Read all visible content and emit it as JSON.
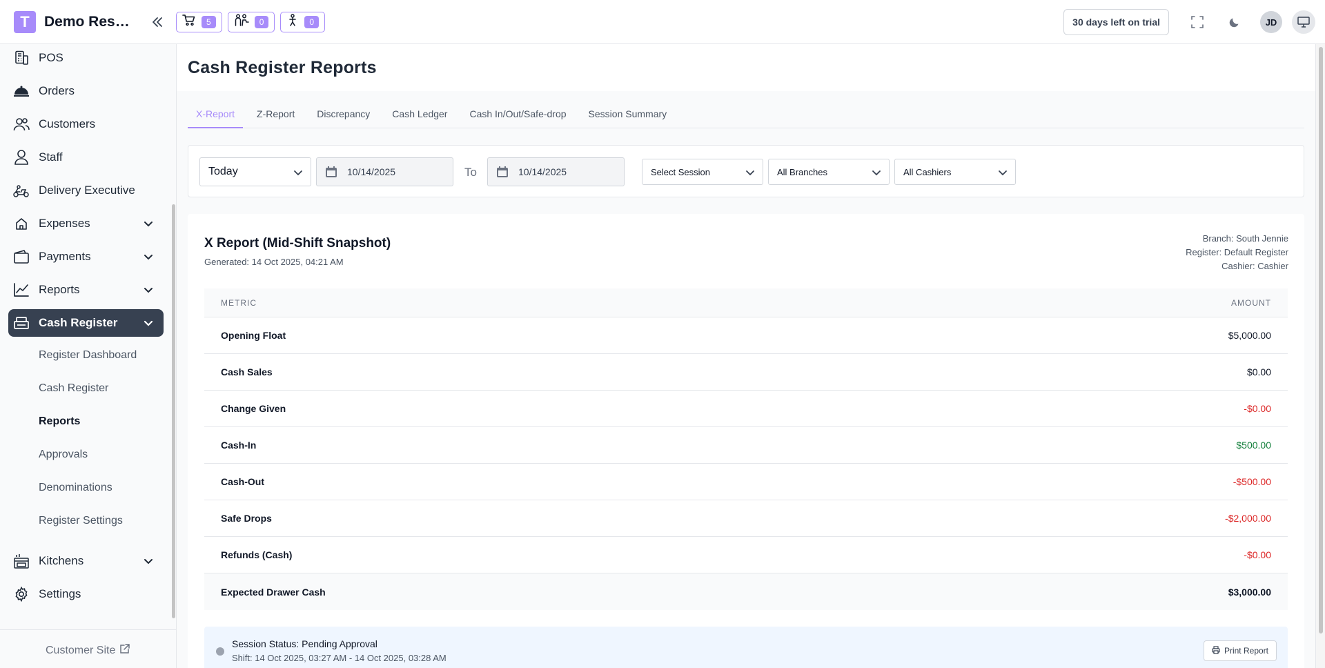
{
  "app": {
    "logo_letter": "T",
    "name": "Demo Restaurant"
  },
  "topbar": {
    "badges": [
      {
        "icon": "cart-icon",
        "count": "5"
      },
      {
        "icon": "waiter-icon",
        "count": "0"
      },
      {
        "icon": "delivery-person-icon",
        "count": "0"
      }
    ],
    "trial": "30 days left on trial",
    "user_initials": "JD"
  },
  "sidebar": {
    "items": [
      {
        "label": "POS",
        "icon": "pos-icon"
      },
      {
        "label": "Orders",
        "icon": "cloche-icon"
      },
      {
        "label": "Customers",
        "icon": "users-icon"
      },
      {
        "label": "Staff",
        "icon": "user-icon"
      },
      {
        "label": "Delivery Executive",
        "icon": "scooter-icon"
      },
      {
        "label": "Expenses",
        "icon": "expenses-icon"
      },
      {
        "label": "Payments",
        "icon": "wallet-icon"
      },
      {
        "label": "Reports",
        "icon": "chart-icon"
      },
      {
        "label": "Cash Register",
        "icon": "register-icon"
      },
      {
        "label": "Kitchens",
        "icon": "kitchen-icon"
      },
      {
        "label": "Settings",
        "icon": "gear-icon"
      }
    ],
    "cash_register_sub": [
      "Register Dashboard",
      "Cash Register",
      "Reports",
      "Approvals",
      "Denominations",
      "Register Settings"
    ],
    "customer_site": "Customer Site"
  },
  "page": {
    "title": "Cash Register Reports",
    "tabs": [
      "X-Report",
      "Z-Report",
      "Discrepancy",
      "Cash Ledger",
      "Cash In/Out/Safe-drop",
      "Session Summary"
    ],
    "active_tab": "X-Report"
  },
  "filters": {
    "period": "Today",
    "date_from": "10/14/2025",
    "to_label": "To",
    "date_to": "10/14/2025",
    "session": "Select Session",
    "branch": "All Branches",
    "cashier": "All Cashiers"
  },
  "report": {
    "title": "X Report (Mid-Shift Snapshot)",
    "generated": "Generated: 14 Oct 2025, 04:21 AM",
    "branch": "Branch: South Jennie",
    "register": "Register: Default Register",
    "cashier": "Cashier: Cashier",
    "col_metric": "METRIC",
    "col_amount": "AMOUNT",
    "rows": [
      {
        "label": "Opening Float",
        "value": "$5,000.00",
        "color": "#111827"
      },
      {
        "label": "Cash Sales",
        "value": "$0.00",
        "color": "#111827"
      },
      {
        "label": "Change Given",
        "value": "-$0.00",
        "color": "#dc2626"
      },
      {
        "label": "Cash-In",
        "value": "$500.00",
        "color": "#15803d"
      },
      {
        "label": "Cash-Out",
        "value": "-$500.00",
        "color": "#dc2626"
      },
      {
        "label": "Safe Drops",
        "value": "-$2,000.00",
        "color": "#dc2626"
      },
      {
        "label": "Refunds (Cash)",
        "value": "-$0.00",
        "color": "#dc2626"
      }
    ],
    "total_label": "Expected Drawer Cash",
    "total_value": "$3,000.00",
    "status": "Session Status: Pending Approval",
    "shift": "Shift: 14 Oct 2025, 03:27 AM - 14 Oct 2025, 03:28 AM",
    "print_label": "Print Report"
  },
  "colors": {
    "accent": "#a78bfa",
    "active_nav": "#374151",
    "negative": "#dc2626",
    "positive": "#15803d"
  }
}
